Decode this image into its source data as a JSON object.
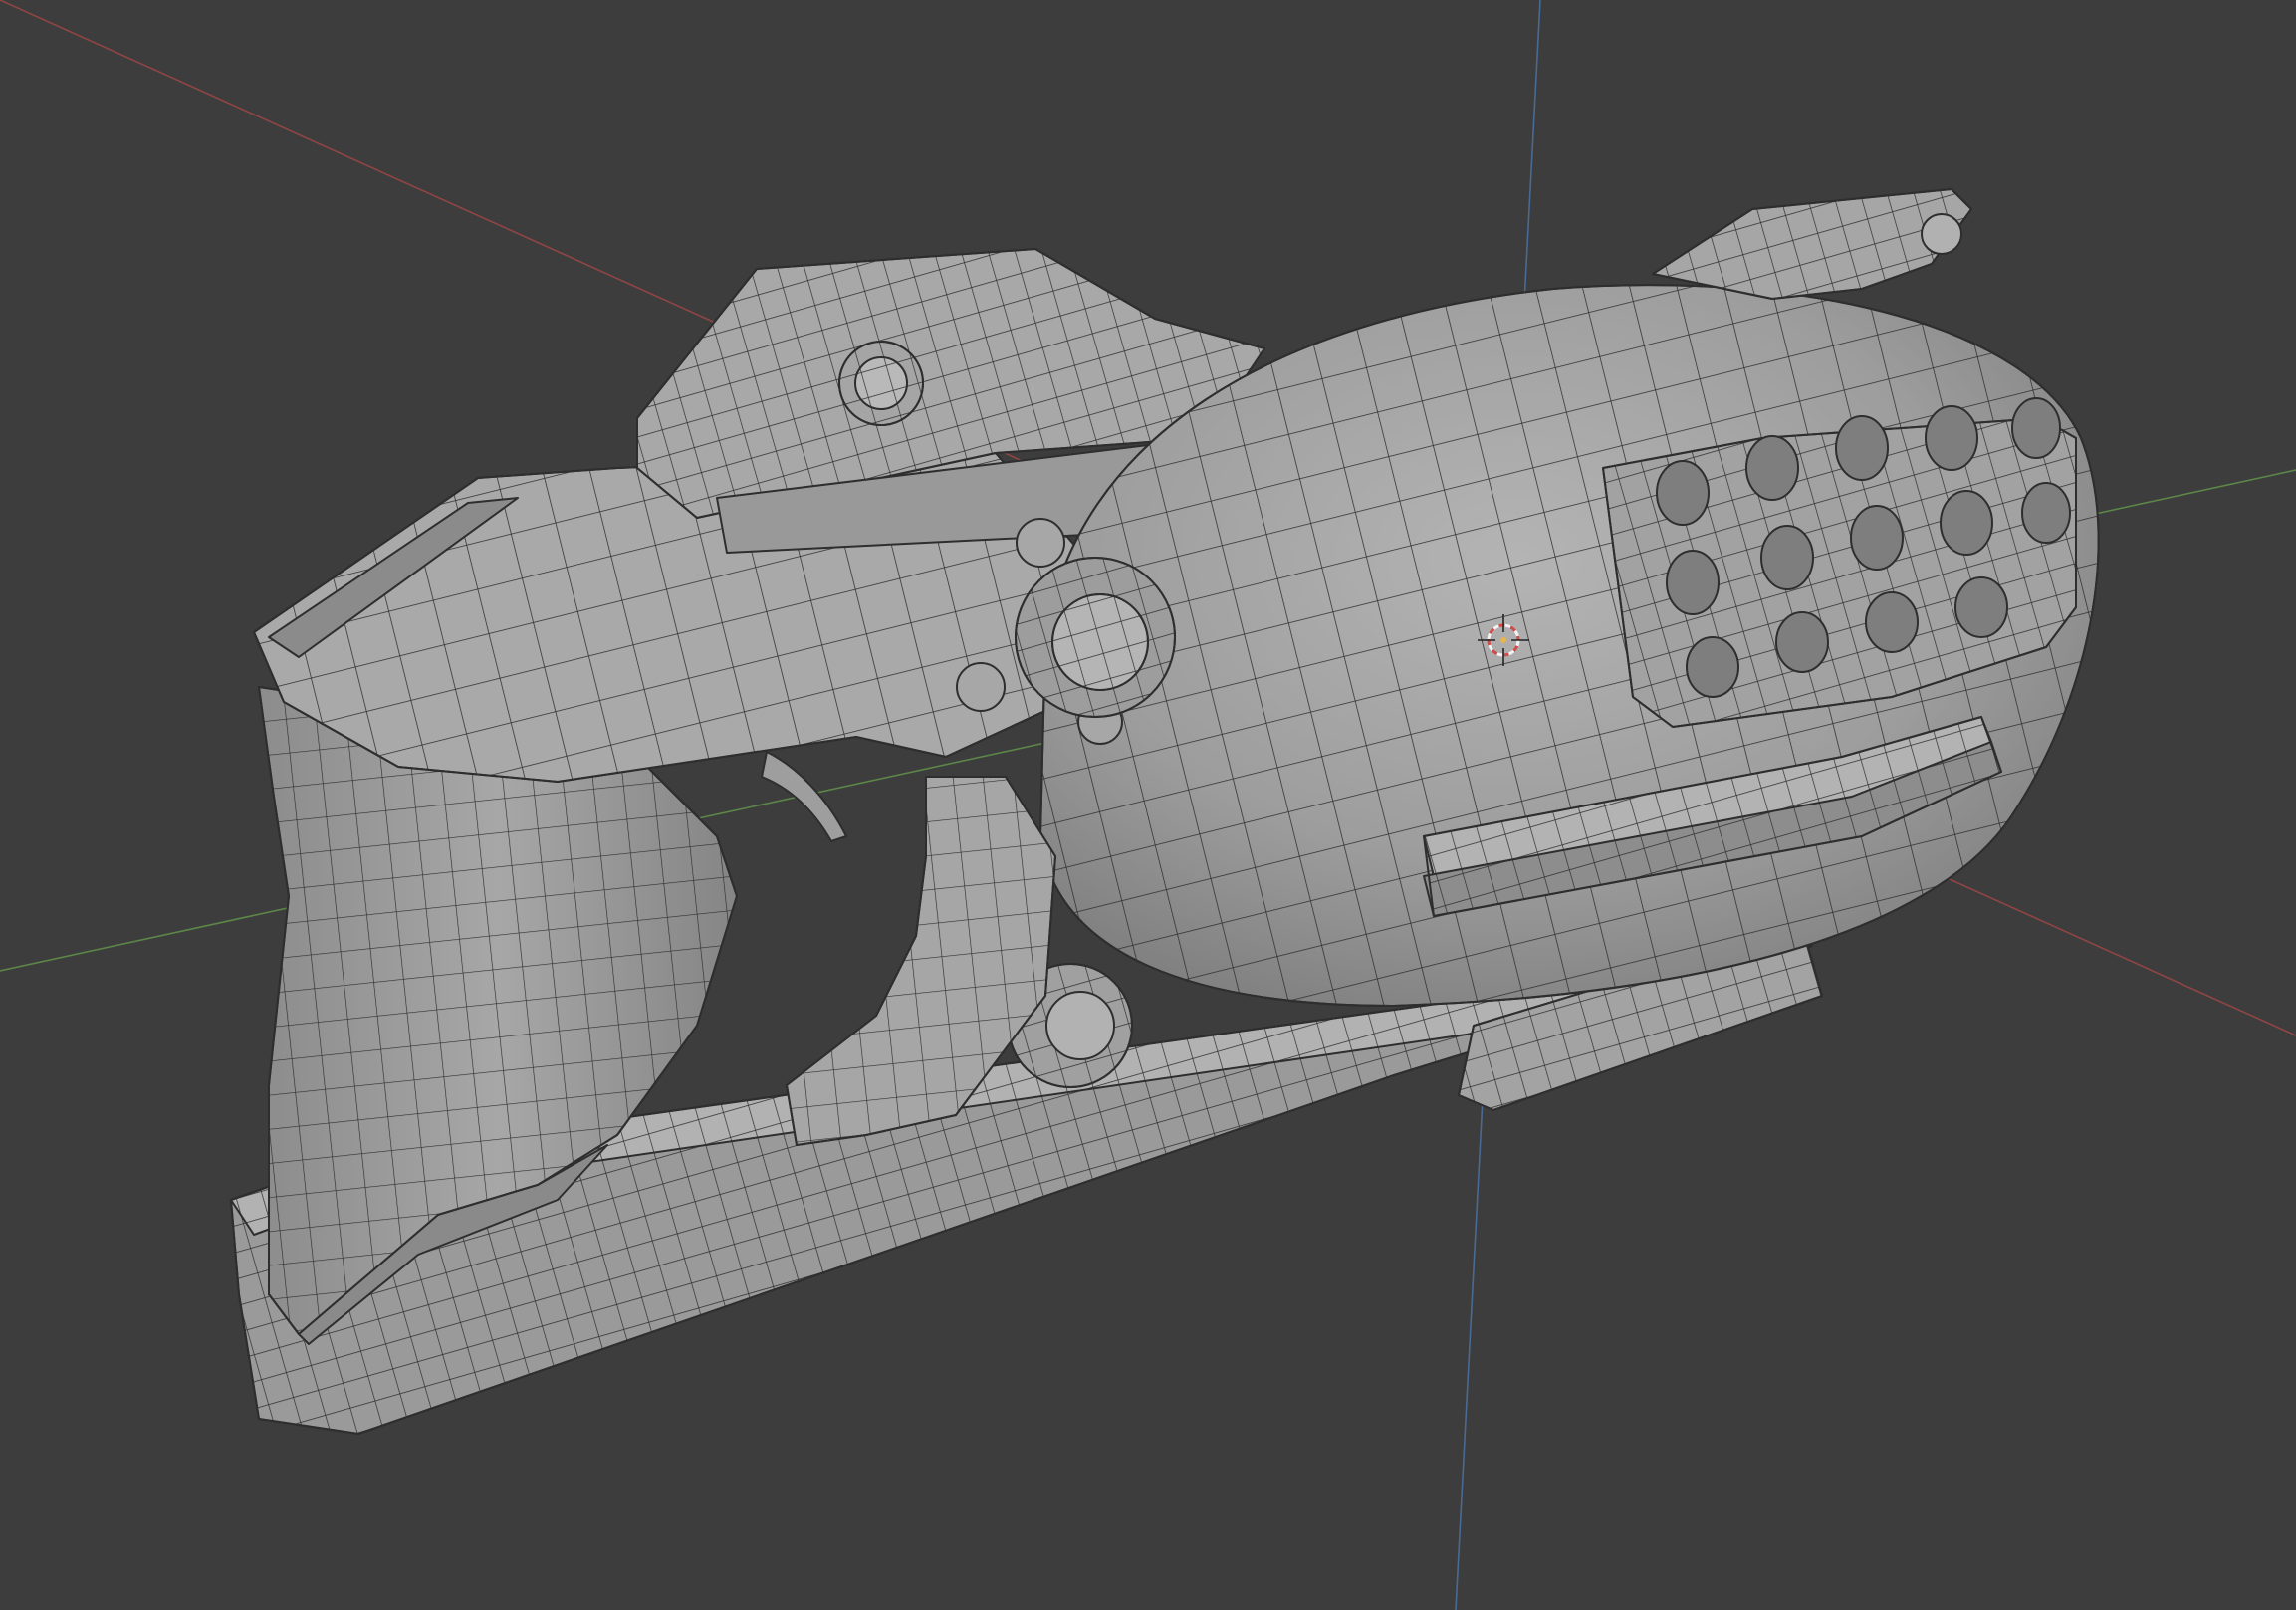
{
  "viewport": {
    "background": "#3d3d3d",
    "view": "3D Viewport",
    "shading": "solid",
    "overlay": "wireframe"
  },
  "axes": {
    "x_color": "#9a4646",
    "y_color": "#5f8f4a",
    "z_color": "#4a6f9e"
  },
  "object": {
    "kind": "stylized pistol mesh",
    "base_color": "#a0a0a0",
    "edge_color": "#2e2e2e"
  },
  "cursor": {
    "kind": "3d-cursor",
    "ring_color_a": "#d24b4b",
    "ring_color_b": "#f2f2f2"
  }
}
